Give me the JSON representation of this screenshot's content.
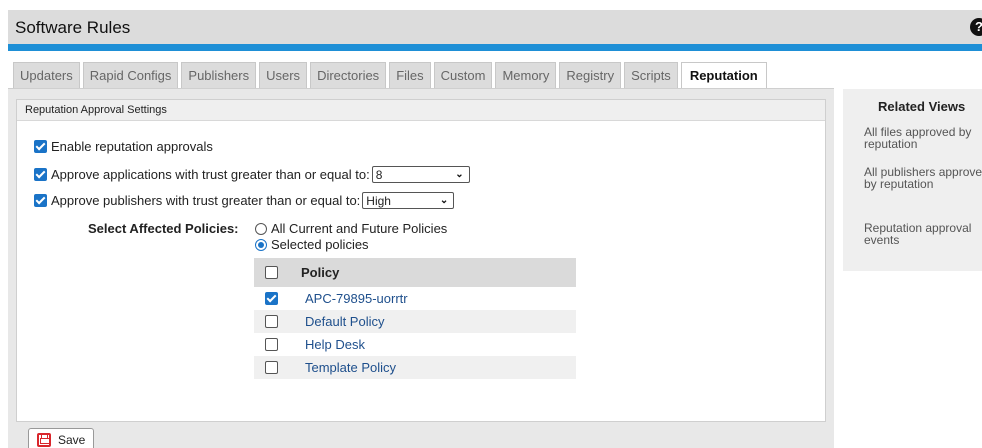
{
  "header": {
    "title": "Software Rules",
    "help_glyph": "?"
  },
  "tabs": [
    {
      "label": "Updaters",
      "active": false
    },
    {
      "label": "Rapid Configs",
      "active": false
    },
    {
      "label": "Publishers",
      "active": false
    },
    {
      "label": "Users",
      "active": false
    },
    {
      "label": "Directories",
      "active": false
    },
    {
      "label": "Files",
      "active": false
    },
    {
      "label": "Custom",
      "active": false
    },
    {
      "label": "Memory",
      "active": false
    },
    {
      "label": "Registry",
      "active": false
    },
    {
      "label": "Scripts",
      "active": false
    },
    {
      "label": "Reputation",
      "active": true
    }
  ],
  "settings": {
    "section_title": "Reputation Approval Settings",
    "enable_label": "Enable reputation approvals",
    "enable_checked": true,
    "app_trust_label": "Approve applications with trust greater than or equal to:",
    "app_trust_checked": true,
    "app_trust_value": "8",
    "publisher_trust_label": "Approve publishers with trust greater than or equal to:",
    "publisher_trust_checked": true,
    "publisher_trust_value": "High",
    "policies_label": "Select Affected Policies:",
    "radio_all_label": "All Current and Future Policies",
    "radio_all_selected": false,
    "radio_selected_label": "Selected policies",
    "radio_selected_selected": true
  },
  "policy_table": {
    "header": "Policy",
    "rows": [
      {
        "name": "APC-79895-uorrtr",
        "checked": true
      },
      {
        "name": "Default Policy",
        "checked": false
      },
      {
        "name": "Help Desk",
        "checked": false
      },
      {
        "name": "Template Policy",
        "checked": false
      }
    ]
  },
  "save_label": "Save",
  "related": {
    "title": "Related Views",
    "links": [
      "All files approved by reputation",
      "All publishers approved by reputation",
      "Reputation approval events"
    ]
  },
  "colors": {
    "accent_bar": "#1e8fd6",
    "checkbox": "#1a73c7",
    "link": "#1e4f8c",
    "save_icon": "#d9262c"
  }
}
